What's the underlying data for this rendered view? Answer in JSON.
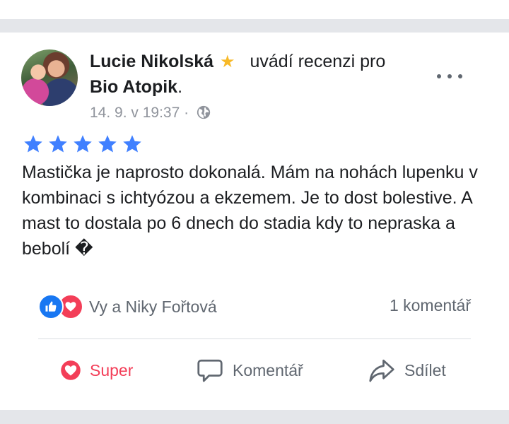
{
  "post": {
    "author": "Lucie Nikolská",
    "verb": "uvádí recenzi pro",
    "page": "Bio Atopik",
    "page_suffix": ".",
    "timestamp": "14. 9. v 19:37",
    "meta_separator": "·",
    "privacy_icon": "globe-icon",
    "rating": 5,
    "rating_max": 5,
    "review_text": "Mastička je naprosto dokonalá. Mám na nohách lupenku v kombinaci s ichtyózou a ekzemem. Je to dost bolestive. A mast to dostala po 6 dnech do stadia kdy to nepraska a bebolí �"
  },
  "reactions": {
    "names": "Vy a Niky Fořtová",
    "types": [
      "like",
      "love"
    ],
    "comment_count": "1 komentář"
  },
  "actions": {
    "super_label": "Super",
    "comment_label": "Komentář",
    "share_label": "Sdílet"
  },
  "colors": {
    "star": "#4080ff",
    "badge_star": "#f7b928",
    "like": "#1877f2",
    "love": "#f33e58",
    "muted": "#606770",
    "separator": "#e4e6ea"
  }
}
